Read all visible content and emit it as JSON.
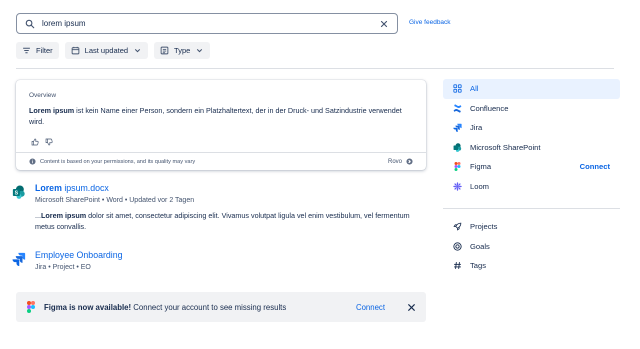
{
  "search": {
    "value": "lorem ipsum",
    "feedback_label": "Give feedback"
  },
  "filters": [
    {
      "label": "Filter"
    },
    {
      "label": "Last updated"
    },
    {
      "label": "Type"
    }
  ],
  "overview": {
    "label": "Overview",
    "bold_lead": "Lorem ipsum",
    "text": " ist kein Name einer Person, sondern ein Platzhaltertext, der in der Druck- und Satzindustrie verwendet wird.",
    "disclaimer": "Content is based on your permissions, and its quality may vary",
    "brand": "Rovo"
  },
  "results": [
    {
      "title_bold": "Lorem",
      "title_rest": " ipsum.docx",
      "meta": "Microsoft SharePoint • Word • Updated vor 2 Tagen",
      "snippet_prefix": "...",
      "snippet_bold": "Lorem ipsum",
      "snippet_rest": " dolor sit amet, consectetur adipiscing elit. Vivamus volutpat ligula vel enim vestibulum, vel fermentum metus convallis."
    },
    {
      "title": "Employee Onboarding",
      "meta": "Jira • Project • EO"
    }
  ],
  "banner": {
    "bold": "Figma is now available!",
    "text": " Connect your account to see missing results",
    "connect": "Connect"
  },
  "sidebar": {
    "products": [
      {
        "label": "All",
        "icon": "grid-icon",
        "active": true
      },
      {
        "label": "Confluence",
        "icon": "confluence-icon"
      },
      {
        "label": "Jira",
        "icon": "jira-icon"
      },
      {
        "label": "Microsoft SharePoint",
        "icon": "sharepoint-icon"
      },
      {
        "label": "Figma",
        "icon": "figma-icon",
        "action": "Connect"
      },
      {
        "label": "Loom",
        "icon": "loom-icon"
      }
    ],
    "more": [
      {
        "label": "Projects",
        "icon": "rocket-icon"
      },
      {
        "label": "Goals",
        "icon": "target-icon"
      },
      {
        "label": "Tags",
        "icon": "hash-icon"
      }
    ]
  },
  "colors": {
    "accent": "#0c66e4",
    "text": "#172b4d",
    "subtle": "#44546f",
    "active_bg": "#e9f2ff"
  }
}
